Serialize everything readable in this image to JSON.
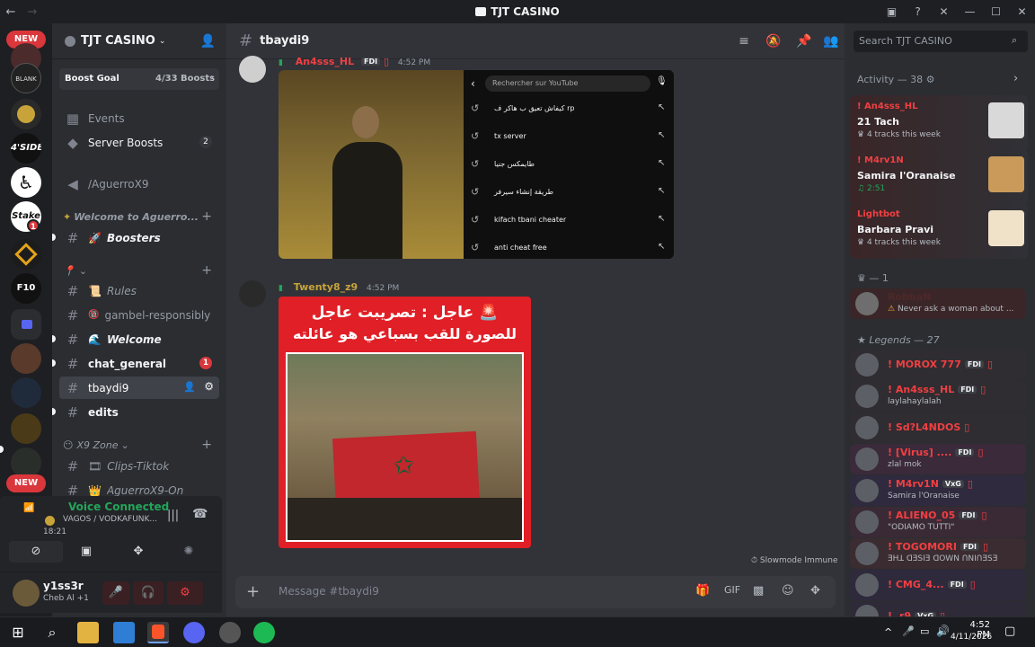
{
  "window": {
    "title": "TJT CASINO"
  },
  "rail": {
    "new_label_top": "NEW",
    "new_label_bottom": "NEW",
    "badge_count": "1",
    "sidebar_label": "4'SIDE"
  },
  "server": {
    "name": "TJT CASINO",
    "boost_goal_label": "Boost Goal",
    "boost_progress": "4/33 Boosts",
    "events": "Events",
    "server_boosts": "Server Boosts",
    "server_boosts_count": "2"
  },
  "channels": {
    "aguerro": "/AguerroX9",
    "cat_welcome": "Welcome to Aguerro...",
    "boosters": "Boosters",
    "rules": "Rules",
    "gambel": "gambel-responsibly",
    "welcome": "Welcome",
    "chat_general": "chat_general",
    "chat_general_badge": "1",
    "tbaydi9": "tbaydi9",
    "edits": "edits",
    "cat_x9": "X9 Zone",
    "clips": "Clips-Tiktok",
    "aguerro_on": "AguerroX9-On"
  },
  "voice": {
    "status": "Voice Connected",
    "channel": "VAGOS / VODKAFUNK...",
    "time": "18:21"
  },
  "user": {
    "name": "y1ss3r",
    "status": "Cheb Al +1"
  },
  "chat": {
    "channel": "tbaydi9",
    "msg1_author": "An4sss_HL",
    "msg1_tag": "FDI",
    "msg1_time": "4:52 PM",
    "yt_placeholder": "Rechercher sur YouTube",
    "yt_items": [
      "كيفاش تعيق ب هاكر ف rp",
      "tx server",
      "طايمكس جنيا",
      "طريقة إنشاء سيرفر",
      "kifach tbani cheater",
      "anti cheat free"
    ],
    "msg2_author": "Twenty8_z9",
    "msg2_time": "4:52 PM",
    "news_line1": "عاجل : تصريبت عاجل 🚨",
    "news_line2": "للصورة للقب بسباعي هو عائلته",
    "slowmode": "Slowmode Immune",
    "composer_placeholder": "Message #tbaydi9"
  },
  "members": {
    "search_placeholder": "Search TJT CASINO",
    "activity_header": "Activity — 38",
    "activities": [
      {
        "user": "! An4sss_HL",
        "title": "21 Tach",
        "detail": "4 tracks this week"
      },
      {
        "user": "! M4rv1N",
        "title": "Samira l'Oranaise",
        "detail": "2:51"
      },
      {
        "user": "Lightbot",
        "title": "Barbara Pravi",
        "detail": "4 tracks this week"
      }
    ],
    "group1_header": "— 1",
    "group1_member": {
      "name": "RobbaN",
      "sub": "Never ask a woman about ..."
    },
    "legends_header": "Legends — 27",
    "legends": [
      {
        "name": "! MOROX 777",
        "tag": "FDI",
        "sub": ""
      },
      {
        "name": "! An4sss_HL",
        "tag": "FDI",
        "sub": "laylahaylalah"
      },
      {
        "name": "! Sd?L4NDOS",
        "tag": "",
        "sub": ""
      },
      {
        "name": "! [Virus] ....",
        "tag": "FDI",
        "sub": "zlal mok"
      },
      {
        "name": "! M4rv1N",
        "tag": "VxG",
        "sub": "Samira l'Oranaise"
      },
      {
        "name": "! ALIENO_05",
        "tag": "FDI",
        "sub": "\"ODIAMO TUTTI\""
      },
      {
        "name": "! TOGOMORI",
        "tag": "FDI",
        "sub": "ƎHꓕ ꓷƎSIƎ ꓷOWN ꓵNIꓵƎSƎ"
      },
      {
        "name": "! CMG_4...",
        "tag": "FDI",
        "sub": ""
      },
      {
        "name": "! .r9",
        "tag": "VxG",
        "sub": ""
      }
    ]
  },
  "taskbar": {
    "time": "4:52 PM",
    "date": "4/11/2026"
  },
  "colors": {
    "accent": "#5865f2",
    "danger": "#f23f42",
    "green": "#23a559",
    "bg": "#313338"
  }
}
